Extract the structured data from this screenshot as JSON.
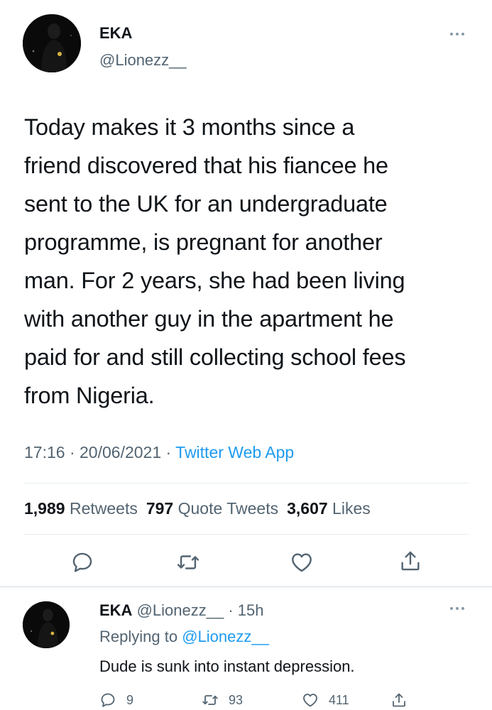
{
  "tweet": {
    "author_name": "EKA",
    "author_handle": "@Lionezz__",
    "text_lines": [
      "Today makes it 3 months since a",
      "friend discovered that his fiancee he",
      "sent to the UK for an undergraduate",
      "programme, is pregnant for another",
      "man. For 2 years, she had been living",
      "with another guy in the apartment he",
      "paid for and still collecting school fees",
      "from Nigeria."
    ],
    "time": "17:16",
    "date": "20/06/2021",
    "source": "Twitter Web App",
    "retweets_count": "1,989",
    "retweets_label": "Retweets",
    "quote_count": "797",
    "quote_label": "Quote Tweets",
    "likes_count": "3,607",
    "likes_label": "Likes",
    "actions": [
      "reply-icon",
      "retweet-icon",
      "like-icon",
      "share-icon"
    ]
  },
  "reply": {
    "author_name": "EKA",
    "author_handle": "@Lionezz__",
    "age": "15h",
    "replying_label": "Replying to",
    "replying_to": "@Lionezz__",
    "text": "Dude is sunk into instant depression.",
    "reply_count": "9",
    "retweet_count": "93",
    "like_count": "411"
  },
  "colors": {
    "text": "#0f1419",
    "secondary": "#536471",
    "accent": "#1d9bf0",
    "divider": "#e6ecf0"
  }
}
